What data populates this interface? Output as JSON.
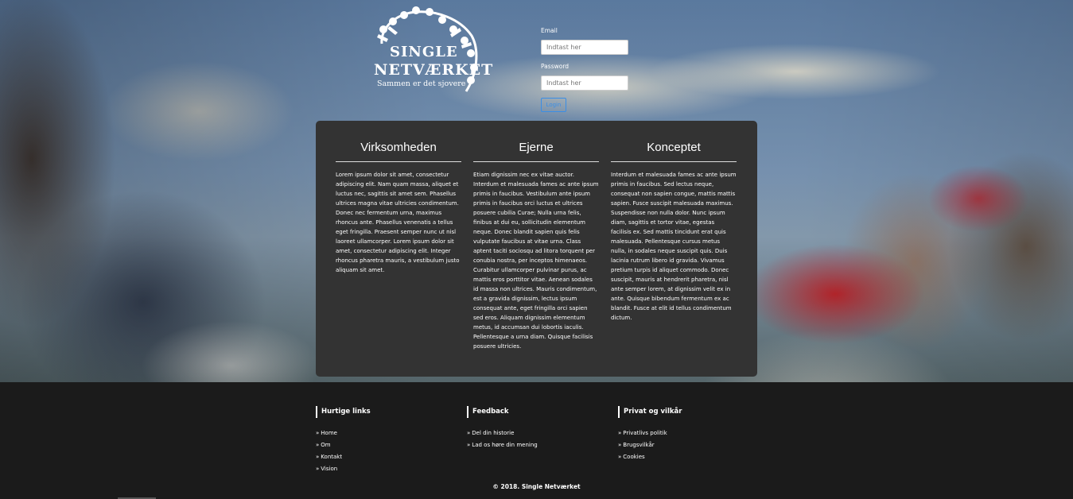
{
  "logo": {
    "line1": "SINGLE",
    "line2": "NETVÆRKET",
    "tagline": "Sammen er det sjovere"
  },
  "login": {
    "email_label": "Email",
    "email_placeholder": "Indtast her",
    "password_label": "Password",
    "password_placeholder": "Indtast her",
    "button_label": "Login"
  },
  "columns": [
    {
      "title": "Virksomheden",
      "text": "Lorem ipsum dolor sit amet, consectetur adipiscing elit. Nam quam massa, aliquet et luctus nec, sagittis sit amet sem. Phasellus ultrices magna vitae ultricies condimentum. Donec nec fermentum urna, maximus rhoncus ante. Phasellus venenatis a tellus eget fringilla. Praesent semper nunc ut nisl laoreet ullamcorper. Lorem ipsum dolor sit amet, consectetur adipiscing elit. Integer rhoncus pharetra mauris, a vestibulum justo aliquam sit amet."
    },
    {
      "title": "Ejerne",
      "text": "Etiam dignissim nec ex vitae auctor. Interdum et malesuada fames ac ante ipsum primis in faucibus. Vestibulum ante ipsum primis in faucibus orci luctus et ultrices posuere cubilia Curae; Nulla urna felis, finibus at dui eu, sollicitudin elementum neque. Donec blandit sapien quis felis vulputate faucibus at vitae urna. Class aptent taciti sociosqu ad litora torquent per conubia nostra, per inceptos himenaeos. Curabitur ullamcorper pulvinar purus, ac mattis eros porttitor vitae. Aenean sodales id massa non ultrices. Mauris condimentum, est a gravida dignissim, lectus ipsum consequat ante, eget fringilla orci sapien sed eros. Aliquam dignissim elementum metus, id accumsan dui lobortis iaculis. Pellentesque a urna diam. Quisque facilisis posuere ultricies."
    },
    {
      "title": "Konceptet",
      "text": "Interdum et malesuada fames ac ante ipsum primis in faucibus. Sed lectus neque, consequat non sapien congue, mattis mattis sapien. Fusce suscipit malesuada maximus. Suspendisse non nulla dolor. Nunc ipsum diam, sagittis et tortor vitae, egestas facilisis ex. Sed mattis tincidunt erat quis malesuada. Pellentesque cursus metus nulla, in sodales neque suscipit quis. Duis lacinia rutrum libero id gravida. Vivamus pretium turpis id aliquet commodo. Donec suscipit, mauris at hendrerit pharetra, nisl ante semper lorem, at dignissim velit ex in ante. Quisque bibendum fermentum ex ac blandit. Fusce at elit id tellus condimentum dictum."
    }
  ],
  "footer": {
    "quick_links": {
      "title": "Hurtige links",
      "items": [
        "Home",
        "Om",
        "Kontakt",
        "Vision"
      ]
    },
    "feedback": {
      "title": "Feedback",
      "items": [
        "Del din historie",
        "Lad os høre din mening"
      ]
    },
    "privacy": {
      "title": "Privat og vilkår",
      "items": [
        "Privatlivs politik",
        "Brugsvilkår",
        "Cookies"
      ]
    },
    "copyright": "© 2018.  Single Netværket"
  }
}
